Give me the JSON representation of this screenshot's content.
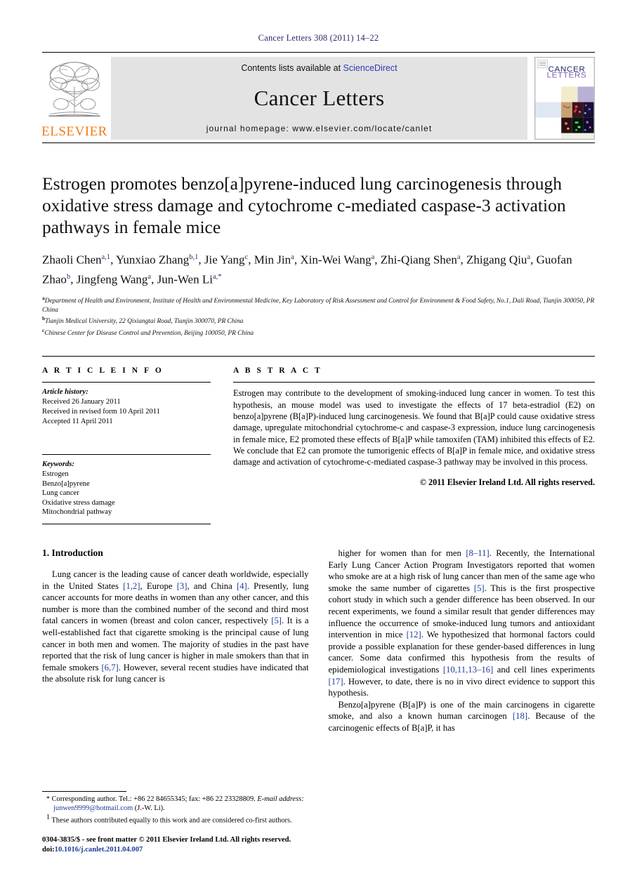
{
  "running_head": "Cancer Letters 308 (2011) 14–22",
  "masthead": {
    "contents_prefix": "Contents lists available at ",
    "sciencedirect": "ScienceDirect",
    "journal_name": "Cancer Letters",
    "homepage": "journal homepage: www.elsevier.com/locate/canlet",
    "publisher_word": "ELSEVIER",
    "cover_title_line1": "CANCER",
    "cover_title_line2": "LETTERS",
    "accent_orange": "#f07d1a",
    "link_blue": "#2f3bb3",
    "cover_blue": "#1f2a6e",
    "cover_purple": "#7c63b4"
  },
  "article": {
    "title": "Estrogen promotes benzo[a]pyrene-induced lung carcinogenesis through oxidative stress damage and cytochrome c-mediated caspase-3 activation pathways in female mice",
    "authors": [
      {
        "name": "Zhaoli Chen",
        "sup": "a,1",
        "sep": ", "
      },
      {
        "name": "Yunxiao Zhang",
        "sup": "b,1",
        "sep": ", "
      },
      {
        "name": "Jie Yang",
        "sup": "c",
        "sep": ", "
      },
      {
        "name": "Min Jin",
        "sup": "a",
        "sep": ", "
      },
      {
        "name": "Xin-Wei Wang",
        "sup": "a",
        "sep": ", "
      },
      {
        "name": "Zhi-Qiang Shen",
        "sup": "a",
        "sep": ", "
      },
      {
        "name": "Zhigang Qiu",
        "sup": "a",
        "sep": ", "
      },
      {
        "name": "Guofan Zhao",
        "sup": "b",
        "sep": ", "
      },
      {
        "name": "Jingfeng Wang",
        "sup": "a",
        "sep": ", "
      },
      {
        "name": "Jun-Wen Li",
        "sup": "a,*",
        "sep": ""
      }
    ],
    "affiliations": [
      {
        "mark": "a",
        "text": "Department of Health and Environment, Institute of Health and Environmental Medicine, Key Laboratory of Risk Assessment and Control for Environment & Food Safety, No.1, Dali Road, Tianjin 300050, PR China"
      },
      {
        "mark": "b",
        "text": "Tianjin Medical University, 22 Qixiangtai Road, Tianjin 300070, PR China"
      },
      {
        "mark": "c",
        "text": "Chinese Center for Disease Control and Prevention, Beijing 100050, PR China"
      }
    ]
  },
  "article_info": {
    "heading": "A R T I C L E   I N F O",
    "history_label": "Article history:",
    "history": [
      "Received 26 January 2011",
      "Received in revised form 10 April 2011",
      "Accepted 11 April 2011"
    ],
    "keywords_label": "Keywords:",
    "keywords": [
      "Estrogen",
      "Benzo[a]pyrene",
      "Lung cancer",
      "Oxidative stress damage",
      "Mitochondrial pathway"
    ]
  },
  "abstract": {
    "heading": "A B S T R A C T",
    "text": "Estrogen may contribute to the development of smoking-induced lung cancer in women. To test this hypothesis, an mouse model was used to investigate the effects of 17 beta-estradiol (E2) on benzo[a]pyrene (B[a]P)-induced lung carcinogenesis. We found that B[a]P could cause oxidative stress damage, upregulate mitochondrial cytochrome-c and caspase-3 expression, induce lung carcinogenesis in female mice, E2 promoted these effects of B[a]P while tamoxifen (TAM) inhibited this effects of E2. We conclude that E2 can promote the tumorigenic effects of B[a]P in female mice, and oxidative stress damage and activation of cytochrome-c-mediated caspase-3 pathway may be involved in this process.",
    "copyright": "© 2011 Elsevier Ireland Ltd. All rights reserved."
  },
  "body": {
    "section_heading": "1. Introduction",
    "left_paragraph": "Lung cancer is the leading cause of cancer death worldwide, especially in the United States [1,2], Europe [3], and China [4]. Presently, lung cancer accounts for more deaths in women than any other cancer, and this number is more than the combined number of the second and third most fatal cancers in women (breast and colon cancer, respectively [5]. It is a well-established fact that cigarette smoking is the principal cause of lung cancer in both men and women. The majority of studies in the past have reported that the risk of lung cancer is higher in male smokers than that in female smokers [6,7]. However, several recent studies have indicated that the absolute risk for lung cancer is",
    "right_paragraph_1": "higher for women than for men [8–11]. Recently, the International Early Lung Cancer Action Program Investigators reported that women who smoke are at a high risk of lung cancer than men of the same age who smoke the same number of cigarettes [5]. This is the first prospective cohort study in which such a gender difference has been observed. In our recent experiments, we found a similar result that gender differences may influence the occurrence of smoke-induced lung tumors and antioxidant intervention in mice [12]. We hypothesized that hormonal factors could provide a possible explanation for these gender-based differences in lung cancer. Some data confirmed this hypothesis from the results of epidemiological investigations [10,11,13–16] and cell lines experiments [17]. However, to date, there is no in vivo direct evidence to support this hypothesis.",
    "right_paragraph_2": "Benzo[a]pyrene (B[a]P) is one of the main carcinogens in cigarette smoke, and also a known human carcinogen [18]. Because of the carcinogenic effects of B[a]P, it has"
  },
  "footnotes": {
    "corresponding_mark": "*",
    "corresponding_text": "Corresponding author. Tel.: +86 22 84655345; fax: +86 22 23328809.",
    "email_label": "E-mail address:",
    "email": "junwen9999@hotmail.com",
    "email_owner": "(J.-W. Li).",
    "equal_mark": "1",
    "equal_text": "These authors contributed equally to this work and are considered co-first authors."
  },
  "imprint": {
    "line1": "0304-3835/$ - see front matter © 2011 Elsevier Ireland Ltd. All rights reserved.",
    "doi_prefix": "doi:",
    "doi": "10.1016/j.canlet.2011.04.007"
  }
}
